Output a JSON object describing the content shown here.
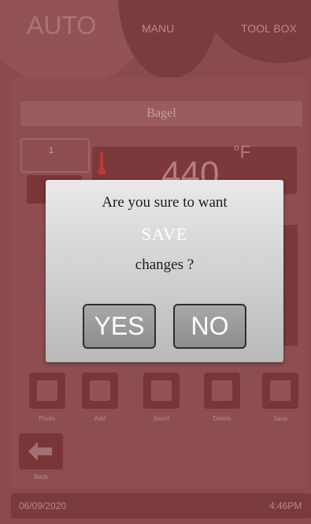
{
  "tabs": {
    "auto": "AUTO",
    "manu": "MANU",
    "toolbox": "TOOL BOX"
  },
  "recipe": {
    "name": "Bagel"
  },
  "step": {
    "number": "1"
  },
  "temperature": {
    "value": "440",
    "unit": "°F"
  },
  "toolbar": [
    {
      "label": "Photo",
      "icon": "photo-icon"
    },
    {
      "label": "Add",
      "icon": "add-icon"
    },
    {
      "label": "Insert",
      "icon": "insert-icon"
    },
    {
      "label": "Delete",
      "icon": "delete-icon"
    },
    {
      "label": "Save",
      "icon": "save-icon"
    }
  ],
  "back": {
    "label": "Back",
    "icon": "back-arrow-icon"
  },
  "status": {
    "date": "06/09/2020",
    "time": "4:46PM"
  },
  "dialog": {
    "line1": "Are you sure to want",
    "action": "SAVE",
    "line3": "changes ?",
    "yes": "YES",
    "no": "NO"
  }
}
